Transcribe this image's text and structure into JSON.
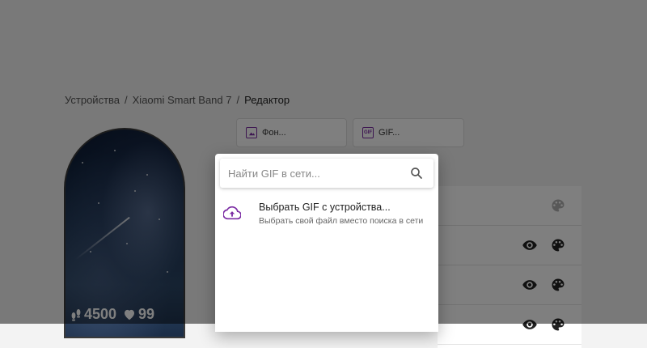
{
  "breadcrumb": {
    "items": [
      "Устройства",
      "Xiaomi Smart Band 7"
    ],
    "current": "Редактор",
    "separator": "/"
  },
  "band_preview": {
    "steps": "4500",
    "heart_rate": "99",
    "steps_icon": "footsteps-icon",
    "heart_icon": "heart-icon"
  },
  "toolbar": {
    "background_label": "Фон...",
    "gif_label": "GIF...",
    "gif_icon_text": "GIF"
  },
  "dialog": {
    "search_placeholder": "Найти GIF в сети...",
    "search_value": "",
    "upload_title": "Выбрать GIF с устройства...",
    "upload_subtitle": "Выбрать свой файл вместо поиска в сети"
  },
  "colors": {
    "accent": "#7a2aa3",
    "overlay": "rgba(0,0,0,0.5)"
  },
  "icons": [
    "search-icon",
    "cloud-upload-icon",
    "eye-icon",
    "palette-icon",
    "image-icon",
    "gif-icon"
  ]
}
